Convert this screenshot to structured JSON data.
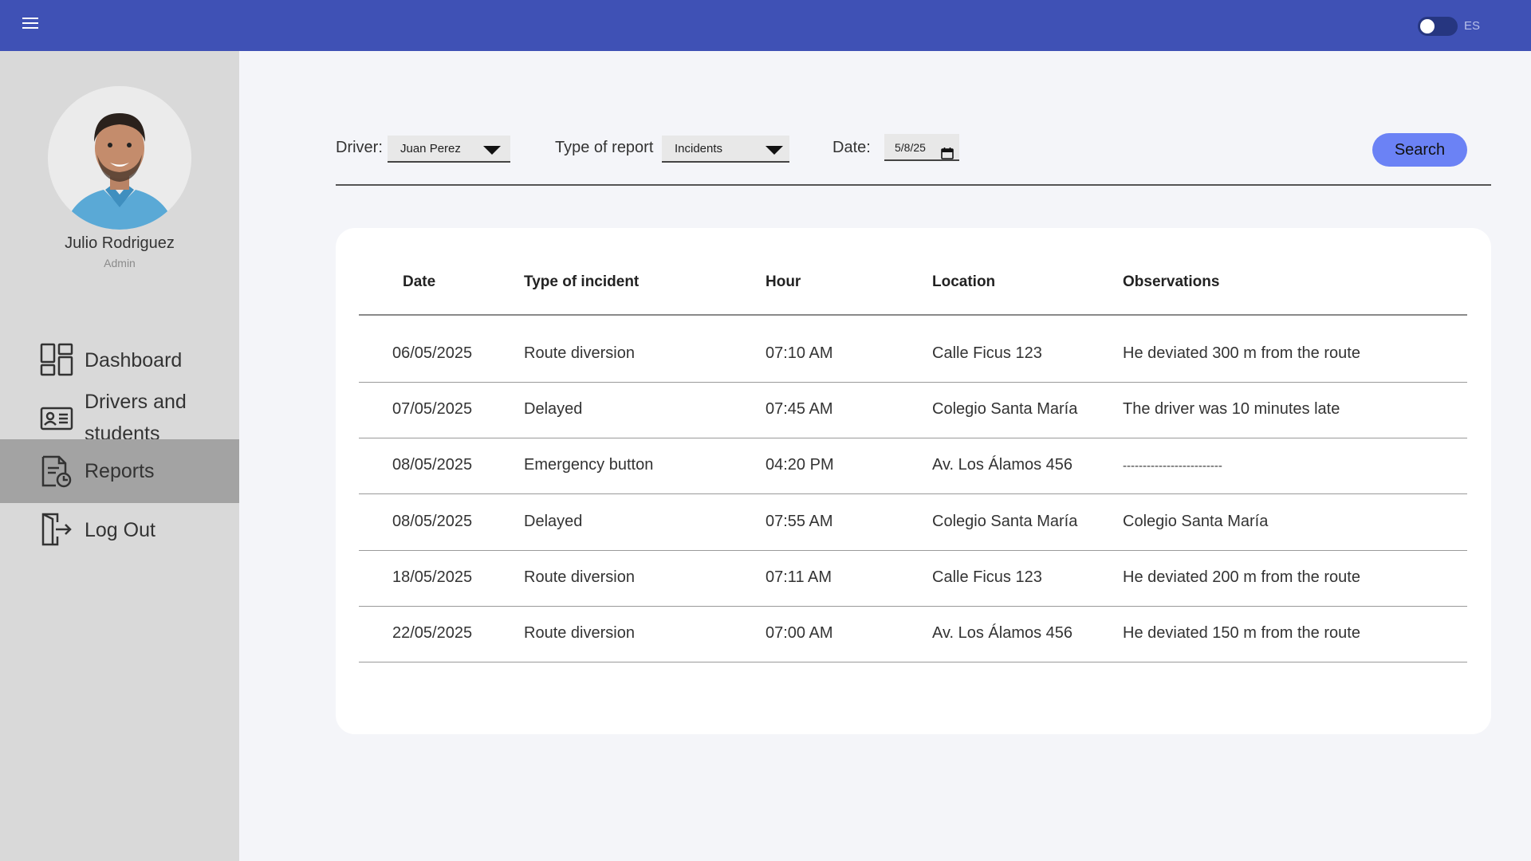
{
  "topbar": {
    "menu_icon": "hamburger-menu-icon",
    "language_label": "ES",
    "toggle_on": false,
    "bar_color": "#3f51b5"
  },
  "sidebar": {
    "user": {
      "name": "Julio Rodriguez",
      "role": "Admin"
    },
    "items": [
      {
        "label": "Dashboard",
        "icon": "dashboard-icon",
        "active": false
      },
      {
        "label": "Drivers and students",
        "icon": "id-card-icon",
        "active": false
      },
      {
        "label": "Reports",
        "icon": "report-document-icon",
        "active": true
      },
      {
        "label": "Log Out",
        "icon": "logout-icon",
        "active": false
      }
    ]
  },
  "filters": {
    "driver_label": "Driver:",
    "driver_value": "Juan Perez",
    "report_label": "Type of report",
    "report_value": "Incidents",
    "date_label": "Date:",
    "date_value": "5/8/25",
    "search_label": "Search",
    "accent": "#6b82f5"
  },
  "table": {
    "headers": [
      "Date",
      "Type of incident",
      "Hour",
      "Location",
      "Observations"
    ],
    "rows": [
      [
        "06/05/2025",
        "Route diversion",
        "07:10 AM",
        "Calle Ficus 123",
        "He deviated 300 m from the route"
      ],
      [
        "07/05/2025",
        "Delayed",
        "07:45 AM",
        "Colegio Santa María",
        "The driver was 10 minutes late"
      ],
      [
        "08/05/2025",
        "Emergency button",
        "04:20 PM",
        "Av. Los Álamos 456",
        "-------------------------"
      ],
      [
        "08/05/2025",
        "Delayed",
        "07:55 AM",
        "Colegio Santa María",
        "Colegio Santa María"
      ],
      [
        "18/05/2025",
        "Route diversion",
        "07:11 AM",
        "Calle Ficus 123",
        "He deviated 200 m from the route"
      ],
      [
        "22/05/2025",
        "Route diversion",
        "07:00 AM",
        "Av. Los Álamos 456",
        "He deviated 150 m from the route"
      ]
    ]
  }
}
